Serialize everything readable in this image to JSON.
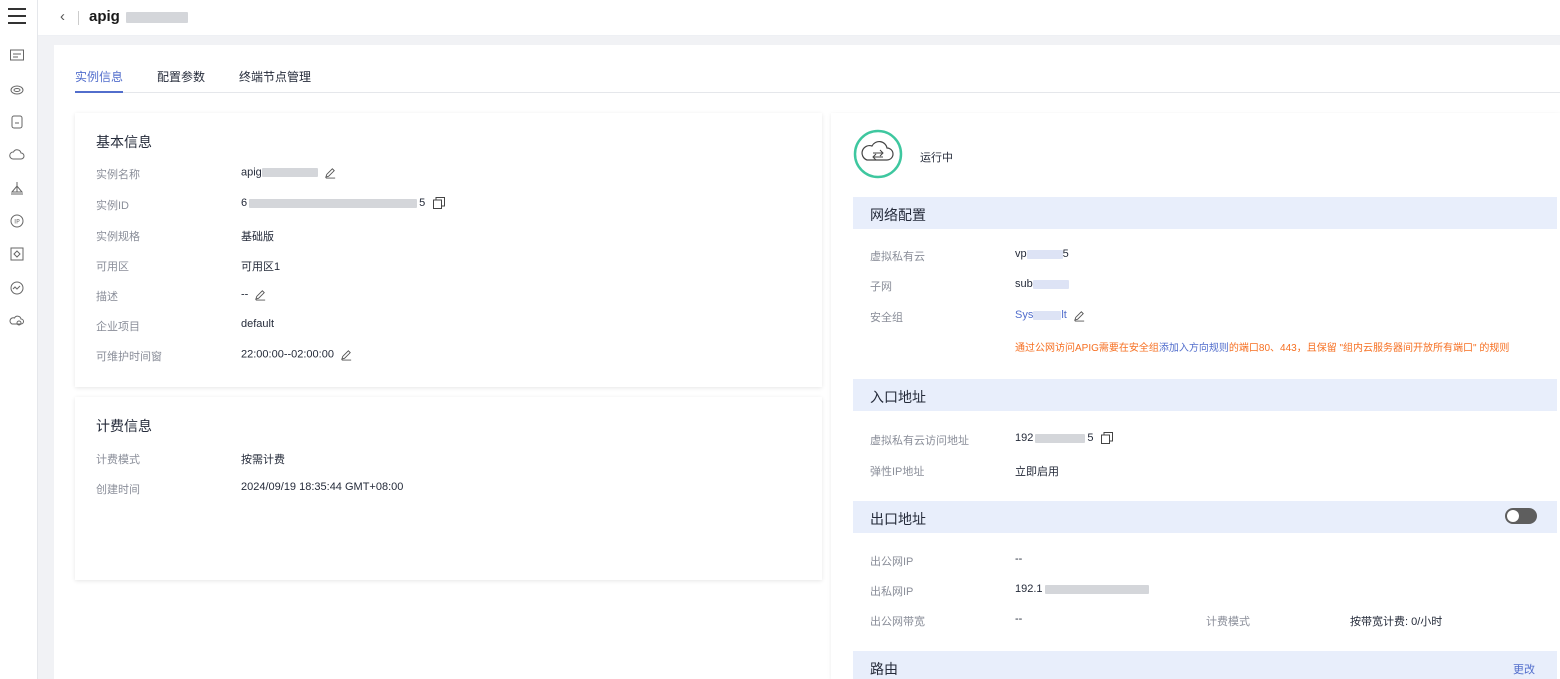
{
  "header": {
    "back_icon": "chevron-left-icon",
    "title": "apig"
  },
  "sidebar": {
    "icons": [
      "menu-icon",
      "instance-icon",
      "cloud-icon",
      "database-icon",
      "cloud-outline-icon",
      "ship-icon",
      "ip-icon",
      "target-icon",
      "chart-icon",
      "gear-cloud-icon"
    ]
  },
  "tabs": [
    {
      "label": "实例信息"
    },
    {
      "label": "配置参数"
    },
    {
      "label": "终端节点管理"
    }
  ],
  "basic": {
    "title": "基本信息",
    "rows": [
      {
        "k": "实例名称",
        "v": "apig"
      },
      {
        "k": "实例ID",
        "v": "6",
        "v_end": "5"
      },
      {
        "k": "实例规格",
        "v": "基础版"
      },
      {
        "k": "可用区",
        "v": "可用区1"
      },
      {
        "k": "描述",
        "v": "--"
      },
      {
        "k": "企业项目",
        "v": "default"
      },
      {
        "k": "可维护时间窗",
        "v": "22:00:00--02:00:00"
      }
    ]
  },
  "billing": {
    "title": "计费信息",
    "rows": [
      {
        "k": "计费模式",
        "v": "按需计费"
      },
      {
        "k": "创建时间",
        "v": "2024/09/19 18:35:44 GMT+08:00"
      }
    ]
  },
  "status": {
    "text": "运行中",
    "color": "#3ec79f"
  },
  "network": {
    "title": "网络配置",
    "vpc_k": "虚拟私有云",
    "vpc_v": "vp",
    "vpc_end": "5",
    "subnet_k": "子网",
    "subnet_v": "sub",
    "sg_k": "安全组",
    "sg_v": "Sys",
    "sg_end": "lt",
    "warn_1": "通过公网访问APIG需要在安全组",
    "warn_link": "添加入方向规则",
    "warn_2": "的端口80、443，且保留 \"组内云服务器间开放所有端口\" 的规则"
  },
  "ingress": {
    "title": "入口地址",
    "vpc_addr_k": "虚拟私有云访问地址",
    "vpc_addr_v": "192",
    "vpc_addr_end": "5",
    "eip_k": "弹性IP地址",
    "eip_v": "立即启用"
  },
  "egress": {
    "title": "出口地址",
    "pub_ip_k": "出公网IP",
    "pub_ip_v": "--",
    "priv_ip_k": "出私网IP",
    "priv_ip_v": "192.1",
    "bw_k": "出公网带宽",
    "bw_v": "--",
    "bill_k": "计费模式",
    "bill_v": "按带宽计费: 0/小时"
  },
  "route": {
    "title": "路由",
    "action": "更改"
  },
  "colors": {
    "accent": "#526ecc",
    "band": "#e8eefb",
    "warning": "#f66f21"
  }
}
